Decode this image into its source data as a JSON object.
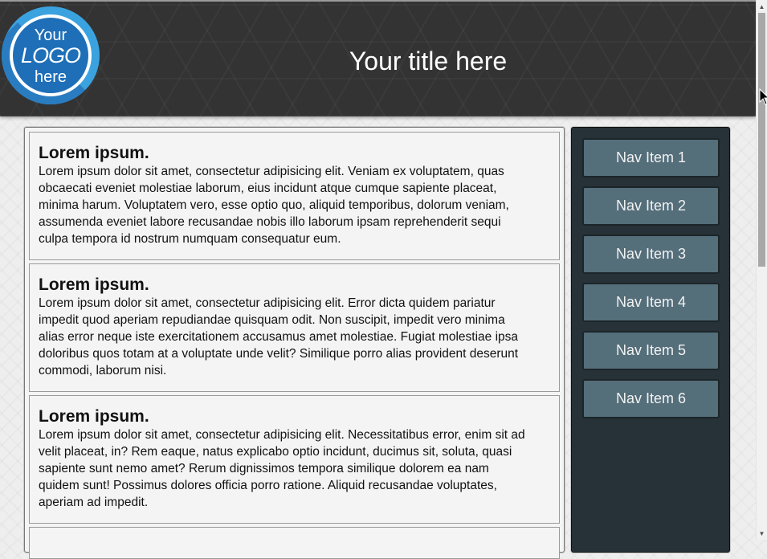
{
  "header": {
    "logo": {
      "line1": "Your",
      "line2": "LOGO",
      "line3": "here"
    },
    "title": "Your title here"
  },
  "articles": [
    {
      "heading": "Lorem ipsum.",
      "lines": [
        "Lorem ipsum dolor sit amet, consectetur adipisicing elit. Veniam ex voluptatem, quas",
        "obcaecati eveniet molestiae laborum, eius incidunt atque cumque sapiente placeat,",
        "minima harum. Voluptatem vero, esse optio quo, aliquid temporibus, dolorum veniam,",
        "assumenda eveniet labore recusandae nobis illo laborum ipsam reprehenderit sequi",
        "culpa tempora id nostrum numquam consequatur eum."
      ]
    },
    {
      "heading": "Lorem ipsum.",
      "lines": [
        "Lorem ipsum dolor sit amet, consectetur adipisicing elit. Error dicta quidem pariatur",
        "impedit quod aperiam repudiandae quisquam odit. Non suscipit, impedit vero minima",
        "alias error neque iste exercitationem accusamus amet molestiae. Fugiat molestiae ipsa",
        "doloribus quos totam at a voluptate unde velit? Similique porro alias provident deserunt",
        "commodi, laborum nisi."
      ]
    },
    {
      "heading": "Lorem ipsum.",
      "lines": [
        "Lorem ipsum dolor sit amet, consectetur adipisicing elit. Necessitatibus error, enim sit ad",
        "velit placeat, in? Rem eaque, natus explicabo optio incidunt, ducimus sit, soluta, quasi",
        "sapiente sunt nemo amet? Rerum dignissimos tempora similique dolorem ea nam",
        "quidem sunt! Possimus dolores officia porro ratione. Aliquid recusandae voluptates,",
        "aperiam ad impedit."
      ]
    }
  ],
  "nav": {
    "items": [
      {
        "label": "Nav Item 1"
      },
      {
        "label": "Nav Item 2"
      },
      {
        "label": "Nav Item 3"
      },
      {
        "label": "Nav Item 4"
      },
      {
        "label": "Nav Item 5"
      },
      {
        "label": "Nav Item 6"
      }
    ]
  },
  "scrollbar": {
    "up_icon": "scroll-up-arrow-icon",
    "down_icon": "scroll-down-arrow-icon"
  },
  "colors": {
    "header_bg": "#333333",
    "sidebar_bg": "#263238",
    "nav_item_bg": "#546e7a",
    "logo_blue": "#1e6fb8",
    "logo_light_blue": "#3aa3df"
  }
}
